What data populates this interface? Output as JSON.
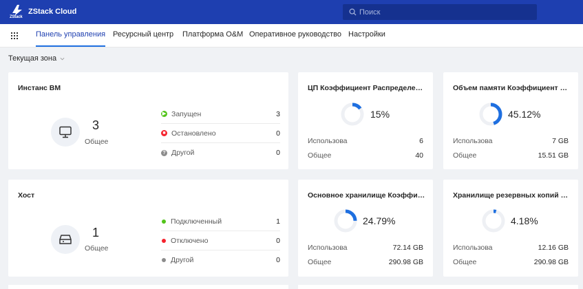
{
  "header": {
    "brand": "ZStack Cloud",
    "logo_sub": "ZStack",
    "search_placeholder": "Поиск"
  },
  "nav": {
    "items": [
      "Панель управления",
      "Ресурсный центр",
      "Платформа O&M",
      "Оперативное руководство",
      "Настройки"
    ],
    "active_index": 0
  },
  "zone": {
    "label": "Текущая зона"
  },
  "cards": {
    "vm": {
      "title": "Инстанс ВМ",
      "total": "3",
      "total_label": "Общее",
      "icon": "monitor-icon",
      "statuses": [
        {
          "label": "Запущен",
          "value": "3",
          "color": "#52c41a",
          "icon": "play-icon"
        },
        {
          "label": "Остановлено",
          "value": "0",
          "color": "#f5222d",
          "icon": "stop-icon"
        },
        {
          "label": "Другой",
          "value": "0",
          "color": "#8c8c8c",
          "icon": "question-icon"
        }
      ]
    },
    "host": {
      "title": "Хост",
      "total": "1",
      "total_label": "Общее",
      "icon": "server-icon",
      "statuses": [
        {
          "label": "Подключенный",
          "value": "1",
          "color": "#52c41a"
        },
        {
          "label": "Отключено",
          "value": "0",
          "color": "#f5222d"
        },
        {
          "label": "Другой",
          "value": "0",
          "color": "#8c8c8c"
        }
      ]
    },
    "cpu": {
      "title": "ЦП Коэффициент Распределения",
      "percent_text": "15%",
      "percent": 15,
      "used_label": "Использова",
      "used": "6",
      "total_label": "Общее",
      "total": "40"
    },
    "memory": {
      "title": "Объем памяти Коэффициент Ра...",
      "percent_text": "45.12%",
      "percent": 45.12,
      "used_label": "Использова",
      "used": "7 GB",
      "total_label": "Общее",
      "total": "15.51 GB"
    },
    "primary_storage": {
      "title": "Основное хранилище Коэффиц...",
      "percent_text": "24.79%",
      "percent": 24.79,
      "used_label": "Использова",
      "used": "72.14 GB",
      "total_label": "Общее",
      "total": "290.98 GB"
    },
    "backup_storage": {
      "title": "Хранилище резервных копий И...",
      "percent_text": "4.18%",
      "percent": 4.18,
      "used_label": "Использова",
      "used": "12.16 GB",
      "total_label": "Общее",
      "total": "290.98 GB"
    }
  },
  "colors": {
    "header_bg": "#1e3fb0",
    "accent": "#1e6fe0",
    "ring_track": "#eef0f4"
  }
}
